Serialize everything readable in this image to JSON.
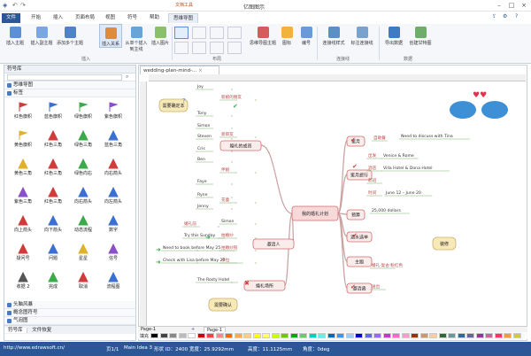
{
  "window": {
    "title": "亿图图示"
  },
  "tabs": [
    "文件",
    "开始",
    "插入",
    "页面布局",
    "视图",
    "符号",
    "帮助",
    "思维导图"
  ],
  "context_tab_label": "文档工具",
  "ribbon": {
    "buttons": [
      "插入主题",
      "插入副主题",
      "添加多个主题",
      "插入关系",
      "从单个插入到主线",
      "插入图片",
      "",
      "",
      "",
      "",
      "思维导图主题",
      "图标",
      "编号",
      "连接线样式",
      "标注连接线",
      "导出数据",
      "创建甘特图"
    ],
    "groups": [
      "插入",
      "布局",
      "",
      "连接线",
      "数据"
    ]
  },
  "left_panel": {
    "title": "符号库",
    "search_placeholder": "",
    "top_category": "思维导图",
    "flag_category": "标签",
    "shapes": [
      "红色旗帜",
      "蓝色旗帜",
      "绿色旗帜",
      "紫色旗帜",
      "黄色旗帜",
      "红色三角",
      "绿色三角",
      "蓝色三角",
      "黄色三角",
      "红色三角",
      "绿色向右",
      "向右箭头",
      "紫色三角",
      "红色三角",
      "向右箭头",
      "向左箭头",
      "向上箭头",
      "向下箭头",
      "动态流程",
      "数字",
      "疑问号",
      "问题",
      "星星",
      "信号",
      "收据 2",
      "完成",
      "取消",
      "流程图"
    ],
    "bottom_categories": [
      "头脑风暴",
      "概念图符号",
      "气泡图"
    ],
    "bottom_tabs": [
      "符号库",
      "文件恢复"
    ]
  },
  "document": {
    "tab_label": "wedding-plan-mind-..."
  },
  "mindmap": {
    "center": "我的婚礼计划",
    "callouts": [
      "需要确定本",
      "需要确认",
      "装修"
    ],
    "branches": [
      "婚礼的成员",
      "邀请人",
      "婚礼场所",
      "蜜月",
      "蜜月旅行",
      "预算",
      "酒水选单",
      "主题",
      "邀请函"
    ],
    "left_leaves": [
      "Joy",
      "新娘的朋友",
      "Tony",
      "Simon",
      "Steven",
      "新郎友",
      "Cris",
      "Ben",
      "伴娘",
      "Faye",
      "Ryne",
      "Jenny",
      "花童",
      "花童",
      "Simon",
      "婚礼前",
      "Try this Sunday",
      "拍婚纱",
      "Need to book before May 25",
      "拍婚纱照",
      "Check with Lisa before May 20",
      "手拉",
      "The Rosty Hotel"
    ],
    "right_leaves": [
      "自助餐",
      "Need to discuss with Tina",
      "出发",
      "Venice & Rome",
      "酒店",
      "Villa Hotel & Dona Hotel",
      "航班",
      "时间",
      "June 12 – June 20",
      "25,000 dollars",
      "婚礼·复古·粉红色",
      "送出"
    ]
  },
  "pages": {
    "current": "Page-1",
    "tab": "Page-1"
  },
  "colorbar_label": "填充",
  "status": {
    "url": "http://www.edrawsoft.cn/",
    "page": "页1/1",
    "main_idea": "Main Idea 3",
    "shape_id": "形状 ID：2400",
    "width": "宽度：25.9292mm",
    "height": "高度：11.1125mm",
    "angle": "角度：0deg"
  },
  "colors": {
    "accent": "#2b5797",
    "node_stroke": "#d46a6a",
    "leaf_line": "#7fb06f",
    "callout": "#f8e9b8"
  }
}
